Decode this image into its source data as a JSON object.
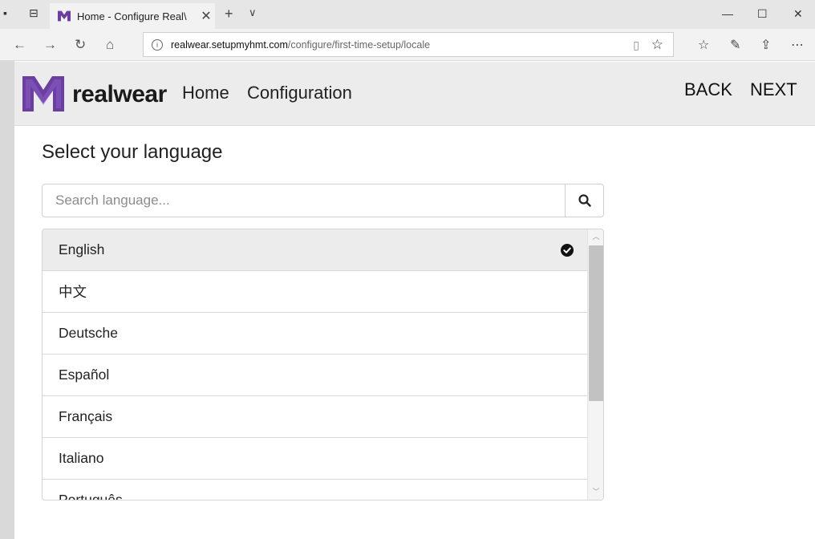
{
  "browser": {
    "tab_title": "Home - Configure Real\\",
    "url_domain": "realwear.setupmyhmt.com",
    "url_path": "/configure/first-time-setup/locale"
  },
  "header": {
    "brand": "realwear",
    "nav": [
      "Home",
      "Configuration"
    ],
    "back_label": "BACK",
    "next_label": "NEXT",
    "brand_color": "#6b3fa0"
  },
  "page": {
    "title": "Select your language",
    "search_placeholder": "Search language...",
    "languages": [
      "English",
      "中文",
      "Deutsche",
      "Español",
      "Français",
      "Italiano",
      "Português"
    ],
    "selected_language": "English"
  }
}
